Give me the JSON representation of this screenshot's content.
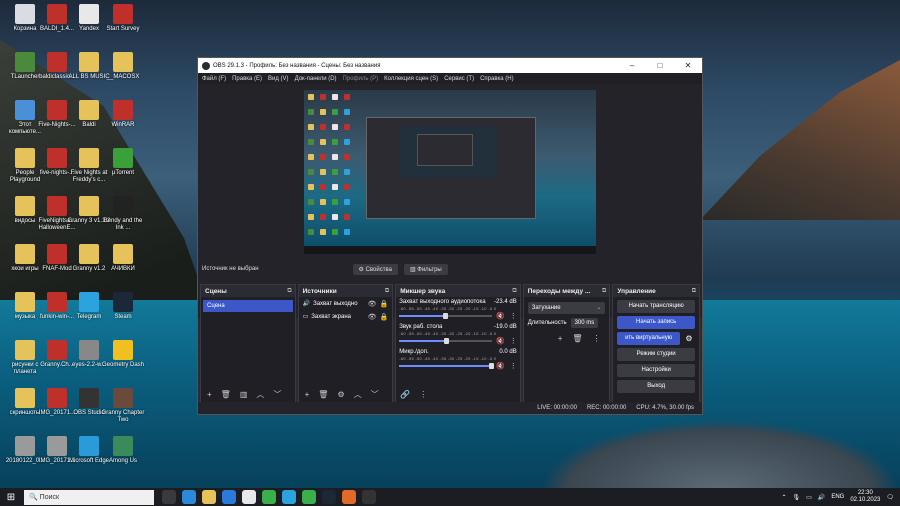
{
  "desktop_icons": [
    {
      "label": "Корзина",
      "color": "#d9dde3"
    },
    {
      "label": "BALDI_1.4...",
      "color": "#c0302a"
    },
    {
      "label": "Yandex",
      "color": "#e8e8e8"
    },
    {
      "label": "Start Survey",
      "color": "#c0302a"
    },
    {
      "label": "TLauncher",
      "color": "#4a8a3a"
    },
    {
      "label": "baldiclassic...",
      "color": "#c0302a"
    },
    {
      "label": "ALL BS MUSIC",
      "color": "#e6c35a"
    },
    {
      "label": "__MACOSX",
      "color": "#e6c35a"
    },
    {
      "label": "Этот компьюте...",
      "color": "#4a90d9"
    },
    {
      "label": "Five-Nights-...",
      "color": "#c0302a"
    },
    {
      "label": "Baldi",
      "color": "#e6c35a"
    },
    {
      "label": "WinRAR",
      "color": "#c0302a"
    },
    {
      "label": "People Playground",
      "color": "#e6c35a"
    },
    {
      "label": "five-nights-...",
      "color": "#c0302a"
    },
    {
      "label": "Five Nights at Freddy's c...",
      "color": "#e6c35a"
    },
    {
      "label": "µTorrent",
      "color": "#3aa13a"
    },
    {
      "label": "видосы",
      "color": "#e6c35a"
    },
    {
      "label": "FiveNightsa... HalloweenE...",
      "color": "#c0302a"
    },
    {
      "label": "Granny 3 v1.1.2",
      "color": "#e6c35a"
    },
    {
      "label": "Bendy and the Ink ...",
      "color": "#222222"
    },
    {
      "label": "хкои игры",
      "color": "#e6c35a"
    },
    {
      "label": "FNAF-Mod",
      "color": "#c0302a"
    },
    {
      "label": "Granny v1.2",
      "color": "#e6c35a"
    },
    {
      "label": "АЧИВКИ",
      "color": "#e6c35a"
    },
    {
      "label": "музыка",
      "color": "#e6c35a"
    },
    {
      "label": "funkin-win-...",
      "color": "#c0302a"
    },
    {
      "label": "Telegram",
      "color": "#2aa3df"
    },
    {
      "label": "Steam",
      "color": "#1b2838"
    },
    {
      "label": "рисунки с планета",
      "color": "#e6c35a"
    },
    {
      "label": "Granny.Ch...",
      "color": "#c0302a"
    },
    {
      "label": "eyes-2.2-w...",
      "color": "#888888"
    },
    {
      "label": "Geometry Dash",
      "color": "#f0c020"
    },
    {
      "label": "скриншоты",
      "color": "#e6c35a"
    },
    {
      "label": "IMG_20171...",
      "color": "#c0302a"
    },
    {
      "label": "OBS Studio",
      "color": "#333333"
    },
    {
      "label": "Granny Chapter Two",
      "color": "#6a4a3a"
    },
    {
      "label": "20180122_0...",
      "color": "#9a9a9a"
    },
    {
      "label": "IMG_20171...",
      "color": "#9a9a9a"
    },
    {
      "label": "Microsoft Edge",
      "color": "#2a9ad9"
    },
    {
      "label": "Among Us",
      "color": "#3a8a5a"
    }
  ],
  "obs": {
    "title": "OBS 29.1.3 - Профиль: Без названия - Сцены: Без названия",
    "menu": [
      {
        "label": "Файл (F)",
        "dim": false
      },
      {
        "label": "Правка (E)",
        "dim": false
      },
      {
        "label": "Вид (V)",
        "dim": false
      },
      {
        "label": "Док-панели (D)",
        "dim": false
      },
      {
        "label": "Профиль (P)",
        "dim": true
      },
      {
        "label": "Коллекция сцен (S)",
        "dim": false
      },
      {
        "label": "Сервис (T)",
        "dim": false
      },
      {
        "label": "Справка (H)",
        "dim": false
      }
    ],
    "source_bar": {
      "no_source": "Источник не выбран",
      "properties": "⚙ Свойства",
      "filters": "▥ Фильтры"
    },
    "scenes": {
      "title": "Сцены",
      "items": [
        "Сцена"
      ]
    },
    "sources": {
      "title": "Источники",
      "items": [
        {
          "icon": "🔊",
          "name": "Захват выходно"
        },
        {
          "icon": "▭",
          "name": "Захват экрана"
        }
      ]
    },
    "mixer": {
      "title": "Микшер звука",
      "scale": "-60 -55 -50 -45 -40 -35 -30 -25 -20 -15 -10 -5 0",
      "channels": [
        {
          "name": "Захват выходного аудиопотока",
          "db": "-23.4 dB",
          "level": 0.5
        },
        {
          "name": "Звук раб. стола",
          "db": "-19.0 dB",
          "level": 0.52
        },
        {
          "name": "Микр./доп.",
          "db": "0.0 dB",
          "level": 1.0
        }
      ]
    },
    "transitions": {
      "title": "Переходы между ...",
      "type": "Затухание",
      "duration_label": "Длительность",
      "duration": "300 ms"
    },
    "controls": {
      "title": "Управление",
      "buttons": [
        "Начать трансляцию",
        "Начать запись",
        "ить виртуальную",
        "Режим студии",
        "Настройки",
        "Выход"
      ]
    },
    "status": {
      "live": "LIVE: 00:00:00",
      "rec": "REC: 00:00:00",
      "cpu": "CPU: 4.7%, 30.00 fps"
    }
  },
  "taskbar": {
    "search": "Поиск",
    "lang": "ENG",
    "time": "22:30",
    "date": "02.10.2023",
    "apps": [
      "#3a3a3a",
      "#2a8ad9",
      "#e6c35a",
      "#2a7ad9",
      "#e8e8e8",
      "#3ab04a",
      "#2aa3df",
      "#3ab04a",
      "#1b2838",
      "#e06a2a",
      "#333333"
    ]
  }
}
